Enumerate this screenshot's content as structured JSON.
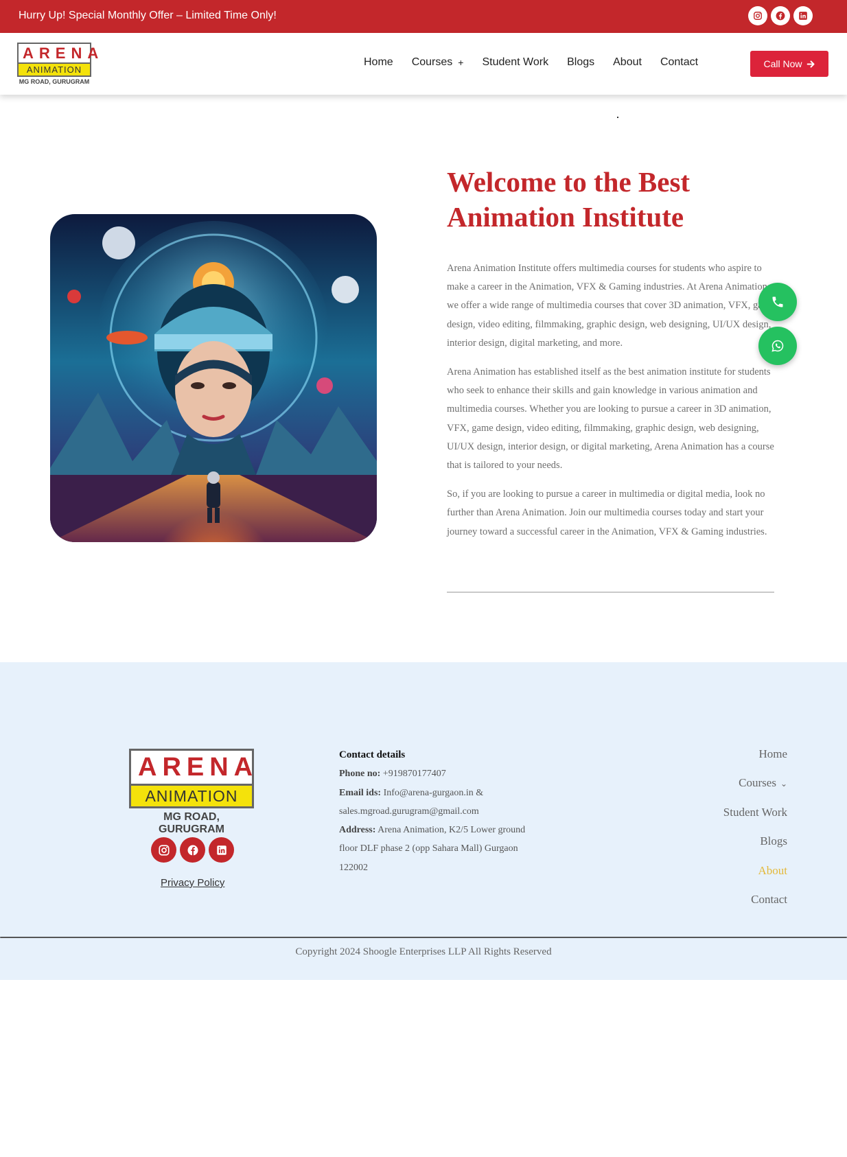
{
  "topbar": {
    "offer_text": "Hurry Up! Special Monthly Offer – Limited Time Only!",
    "social_icons": [
      "instagram-icon",
      "facebook-icon",
      "linkedin-icon"
    ],
    "background": "#c3272b"
  },
  "brand": {
    "line1": "ARENA",
    "line2": "ANIMATION",
    "line3": "MG ROAD, GURUGRAM"
  },
  "nav": {
    "items": [
      {
        "label": "Home"
      },
      {
        "label": "Courses",
        "has_submenu": true
      },
      {
        "label": "Student Work"
      },
      {
        "label": "Blogs"
      },
      {
        "label": "About"
      },
      {
        "label": "Contact"
      }
    ],
    "call_now": "Call Now"
  },
  "hero": {
    "title": "Welcome to the Best Animation Institute",
    "paragraphs": [
      "Arena Animation Institute offers multimedia courses for students who aspire to make a career in the Animation, VFX & Gaming industries. At Arena Animation, we offer a wide range of multimedia courses that cover 3D animation, VFX, game design, video editing, filmmaking, graphic design, web designing, UI/UX design, interior design, digital marketing, and more.",
      "Arena Animation has established itself as the best animation institute for students who seek to enhance their skills and gain knowledge in various animation and multimedia courses. Whether you are looking to pursue a career in 3D animation, VFX, game design, video editing, filmmaking, graphic design, web designing, UI/UX design, interior design, or digital marketing, Arena Animation has a course that is tailored to your needs.",
      "So, if you are looking to pursue a career in multimedia or digital media, look no further than Arena Animation. Join our multimedia courses today and start your journey toward a successful career in the Animation, VFX & Gaming industries."
    ],
    "accent": "#c3272b"
  },
  "floating": {
    "phone_icon": "phone-icon",
    "whatsapp_icon": "whatsapp-icon",
    "color": "#25c160"
  },
  "footer": {
    "privacy": "Privacy Policy",
    "contact_heading": "Contact details",
    "phone_label": "Phone no:",
    "phone_value": "+919870177407",
    "email_label": "Email ids:",
    "email_value": "Info@arena-gurgaon.in & sales.mgroad.gurugram@gmail.com",
    "address_label": "Address:",
    "address_value": "Arena Animation, K2/5 Lower ground floor DLF phase 2 (opp Sahara Mall) Gurgaon 122002",
    "nav": [
      "Home",
      "Courses",
      "Student Work",
      "Blogs",
      "About",
      "Contact"
    ],
    "active_nav": "About",
    "copyright": "Copyright 2024  Shoogle Enterprises LLP All Rights Reserved",
    "background": "#e7f1fb"
  }
}
